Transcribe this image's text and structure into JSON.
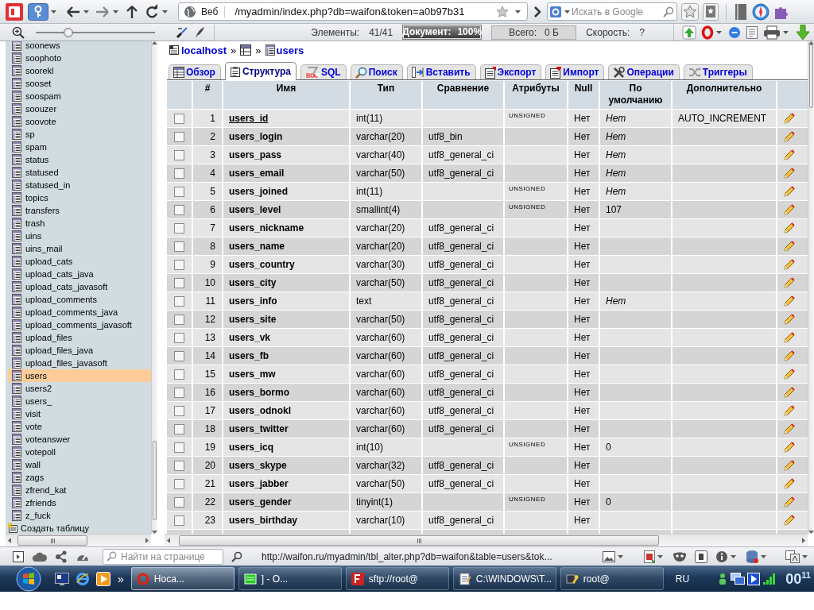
{
  "browser": {
    "address_label": "Веб",
    "address": "/myadmin/index.php?db=waifon&token=a0b97b31",
    "search_placeholder": "Искать в Google",
    "zoom": {
      "level": 0.27
    },
    "stats": [
      {
        "kind": "plain",
        "label": "Элементы:",
        "value": "41/41"
      },
      {
        "kind": "progress",
        "label": "Документ:",
        "value": "100%",
        "level": 1
      },
      {
        "kind": "box",
        "label": "Всего:",
        "value": "0 Б"
      },
      {
        "kind": "plain",
        "label": "Скорость:",
        "value": "?"
      }
    ]
  },
  "sidebar": {
    "items": [
      {
        "label": "soonews",
        "selected": false
      },
      {
        "label": "soophoto",
        "selected": false
      },
      {
        "label": "soorekl",
        "selected": false
      },
      {
        "label": "sooset",
        "selected": false
      },
      {
        "label": "soospam",
        "selected": false
      },
      {
        "label": "soouzer",
        "selected": false
      },
      {
        "label": "soovote",
        "selected": false
      },
      {
        "label": "sp",
        "selected": false
      },
      {
        "label": "spam",
        "selected": false
      },
      {
        "label": "status",
        "selected": false
      },
      {
        "label": "statused",
        "selected": false
      },
      {
        "label": "statused_in",
        "selected": false
      },
      {
        "label": "topics",
        "selected": false
      },
      {
        "label": "transfers",
        "selected": false
      },
      {
        "label": "trash",
        "selected": false
      },
      {
        "label": "uins",
        "selected": false
      },
      {
        "label": "uins_mail",
        "selected": false
      },
      {
        "label": "upload_cats",
        "selected": false
      },
      {
        "label": "upload_cats_java",
        "selected": false
      },
      {
        "label": "upload_cats_javasoft",
        "selected": false
      },
      {
        "label": "upload_comments",
        "selected": false
      },
      {
        "label": "upload_comments_java",
        "selected": false
      },
      {
        "label": "upload_comments_javasoft",
        "selected": false
      },
      {
        "label": "upload_files",
        "selected": false
      },
      {
        "label": "upload_files_java",
        "selected": false
      },
      {
        "label": "upload_files_javasoft",
        "selected": false
      },
      {
        "label": "users",
        "selected": true
      },
      {
        "label": "users2",
        "selected": false
      },
      {
        "label": "users_",
        "selected": false
      },
      {
        "label": "visit",
        "selected": false
      },
      {
        "label": "vote",
        "selected": false
      },
      {
        "label": "voteanswer",
        "selected": false
      },
      {
        "label": "votepoll",
        "selected": false
      },
      {
        "label": "wall",
        "selected": false
      },
      {
        "label": "zags",
        "selected": false
      },
      {
        "label": "zfrend_kat",
        "selected": false
      },
      {
        "label": "zfriends",
        "selected": false
      },
      {
        "label": "z_fuck",
        "selected": false
      }
    ],
    "create_table": "Создать таблицу"
  },
  "breadcrumb": [
    {
      "kind": "server",
      "label": "localhost"
    },
    {
      "kind": "database",
      "separator": "»"
    },
    {
      "kind": "table",
      "separator": "»",
      "label": "users"
    }
  ],
  "tabs": [
    {
      "label": "Обзор",
      "selected": false
    },
    {
      "label": "Структура",
      "selected": true
    },
    {
      "label": "SQL",
      "selected": false
    },
    {
      "label": "Поиск",
      "selected": false
    },
    {
      "label": "Вставить",
      "selected": false
    },
    {
      "label": "Экспорт",
      "selected": false
    },
    {
      "label": "Импорт",
      "selected": false
    },
    {
      "label": "Операции",
      "selected": false
    },
    {
      "label": "Триггеры",
      "selected": false
    }
  ],
  "table": {
    "columns": [
      "#",
      "Имя",
      "Тип",
      "Сравнение",
      "Атрибуты",
      "Null",
      "По умолчанию",
      "Дополнительно"
    ],
    "rows": [
      {
        "number": "1",
        "name": "users_id",
        "primary": true,
        "type": "int(11)",
        "attributes": "UNSIGNED",
        "null": "Нет",
        "default": "Нет",
        "default_none": true,
        "extra": "AUTO_INCREMENT",
        "checked": false
      },
      {
        "number": "2",
        "name": "users_login",
        "primary": false,
        "type": "varchar(20)",
        "collation": "utf8_bin",
        "null": "Нет",
        "default": "Нет",
        "default_none": true,
        "checked": false
      },
      {
        "number": "3",
        "name": "users_pass",
        "primary": false,
        "type": "varchar(40)",
        "collation": "utf8_general_ci",
        "null": "Нет",
        "default": "Нет",
        "default_none": true,
        "checked": false
      },
      {
        "number": "4",
        "name": "users_email",
        "primary": false,
        "type": "varchar(50)",
        "collation": "utf8_general_ci",
        "null": "Нет",
        "default": "Нет",
        "default_none": true,
        "checked": false
      },
      {
        "number": "5",
        "name": "users_joined",
        "primary": false,
        "type": "int(11)",
        "attributes": "UNSIGNED",
        "null": "Нет",
        "default": "Нет",
        "default_none": true,
        "checked": false
      },
      {
        "number": "6",
        "name": "users_level",
        "primary": false,
        "type": "smallint(4)",
        "attributes": "UNSIGNED",
        "null": "Нет",
        "default": "107",
        "default_none": false,
        "checked": false
      },
      {
        "number": "7",
        "name": "users_nickname",
        "primary": false,
        "type": "varchar(20)",
        "collation": "utf8_general_ci",
        "null": "Нет",
        "checked": false
      },
      {
        "number": "8",
        "name": "users_name",
        "primary": false,
        "type": "varchar(20)",
        "collation": "utf8_general_ci",
        "null": "Нет",
        "checked": false
      },
      {
        "number": "9",
        "name": "users_country",
        "primary": false,
        "type": "varchar(30)",
        "collation": "utf8_general_ci",
        "null": "Нет",
        "checked": false
      },
      {
        "number": "10",
        "name": "users_city",
        "primary": false,
        "type": "varchar(50)",
        "collation": "utf8_general_ci",
        "null": "Нет",
        "checked": false
      },
      {
        "number": "11",
        "name": "users_info",
        "primary": false,
        "type": "text",
        "collation": "utf8_general_ci",
        "null": "Нет",
        "default": "Нет",
        "default_none": true,
        "checked": false
      },
      {
        "number": "12",
        "name": "users_site",
        "primary": false,
        "type": "varchar(50)",
        "collation": "utf8_general_ci",
        "null": "Нет",
        "checked": false
      },
      {
        "number": "13",
        "name": "users_vk",
        "primary": false,
        "type": "varchar(60)",
        "collation": "utf8_general_ci",
        "null": "Нет",
        "checked": false
      },
      {
        "number": "14",
        "name": "users_fb",
        "primary": false,
        "type": "varchar(60)",
        "collation": "utf8_general_ci",
        "null": "Нет",
        "checked": false
      },
      {
        "number": "15",
        "name": "users_mw",
        "primary": false,
        "type": "varchar(60)",
        "collation": "utf8_general_ci",
        "null": "Нет",
        "checked": false
      },
      {
        "number": "16",
        "name": "users_bormo",
        "primary": false,
        "type": "varchar(60)",
        "collation": "utf8_general_ci",
        "null": "Нет",
        "checked": false
      },
      {
        "number": "17",
        "name": "users_odnokl",
        "primary": false,
        "type": "varchar(60)",
        "collation": "utf8_general_ci",
        "null": "Нет",
        "checked": false
      },
      {
        "number": "18",
        "name": "users_twitter",
        "primary": false,
        "type": "varchar(60)",
        "collation": "utf8_general_ci",
        "null": "Нет",
        "checked": false
      },
      {
        "number": "19",
        "name": "users_icq",
        "primary": false,
        "type": "int(10)",
        "attributes": "UNSIGNED",
        "null": "Нет",
        "default": "0",
        "default_none": false,
        "checked": false
      },
      {
        "number": "20",
        "name": "users_skype",
        "primary": false,
        "type": "varchar(32)",
        "collation": "utf8_general_ci",
        "null": "Нет",
        "checked": false
      },
      {
        "number": "21",
        "name": "users_jabber",
        "primary": false,
        "type": "varchar(50)",
        "collation": "utf8_general_ci",
        "null": "Нет",
        "checked": false
      },
      {
        "number": "22",
        "name": "users_gender",
        "primary": false,
        "type": "tinyint(1)",
        "attributes": "UNSIGNED",
        "null": "Нет",
        "default": "0",
        "default_none": false,
        "checked": false
      },
      {
        "number": "23",
        "name": "users_birthday",
        "primary": false,
        "type": "varchar(10)",
        "collation": "utf8_general_ci",
        "null": "Нет",
        "checked": false
      }
    ]
  },
  "status_bar": {
    "find_placeholder": "Найти на странице",
    "url": "http://waifon.ru/myadmin/tbl_alter.php?db=waifon&table=users&tok..."
  },
  "taskbar": {
    "more": "»",
    "tasks": [
      {
        "label": "Hoca...",
        "selected": true
      },
      {
        "label": "] - O...",
        "selected": false
      },
      {
        "label": "sftp://root@",
        "selected": false
      },
      {
        "label": "C:\\WINDOWS\\T...",
        "selected": false
      },
      {
        "label": "root@",
        "selected": false
      }
    ],
    "language": "RU",
    "clock": {
      "hours": "00",
      "minutes": "11"
    }
  }
}
